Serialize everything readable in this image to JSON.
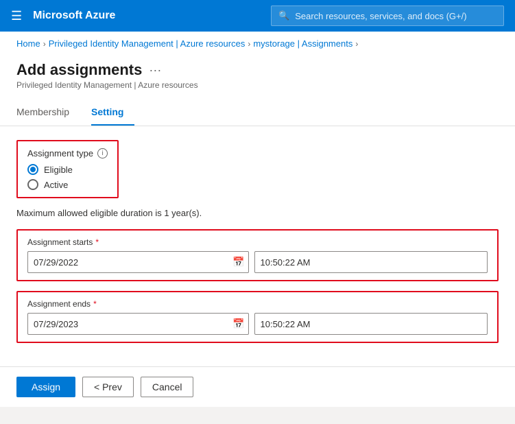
{
  "nav": {
    "hamburger": "☰",
    "brand": "Microsoft Azure",
    "search_placeholder": "Search resources, services, and docs (G+/)",
    "search_icon": "🔍"
  },
  "breadcrumb": {
    "items": [
      {
        "label": "Home",
        "href": "#"
      },
      {
        "label": "Privileged Identity Management | Azure resources",
        "href": "#"
      },
      {
        "label": "mystorage | Assignments",
        "href": "#"
      }
    ]
  },
  "page": {
    "title": "Add assignments",
    "subtitle": "Privileged Identity Management | Azure resources",
    "more_icon": "···"
  },
  "tabs": [
    {
      "label": "Membership",
      "active": false
    },
    {
      "label": "Setting",
      "active": true
    }
  ],
  "form": {
    "assignment_type": {
      "label": "Assignment type",
      "info_icon": "i",
      "options": [
        {
          "label": "Eligible",
          "checked": true
        },
        {
          "label": "Active",
          "checked": false
        }
      ]
    },
    "info_text": "Maximum allowed eligible duration is 1 year(s).",
    "assignment_starts": {
      "label": "Assignment starts",
      "required": true,
      "date_value": "07/29/2022",
      "time_value": "10:50:22 AM"
    },
    "assignment_ends": {
      "label": "Assignment ends",
      "required": true,
      "date_value": "07/29/2023",
      "time_value": "10:50:22 AM"
    }
  },
  "footer": {
    "assign_label": "Assign",
    "prev_label": "< Prev",
    "cancel_label": "Cancel"
  }
}
